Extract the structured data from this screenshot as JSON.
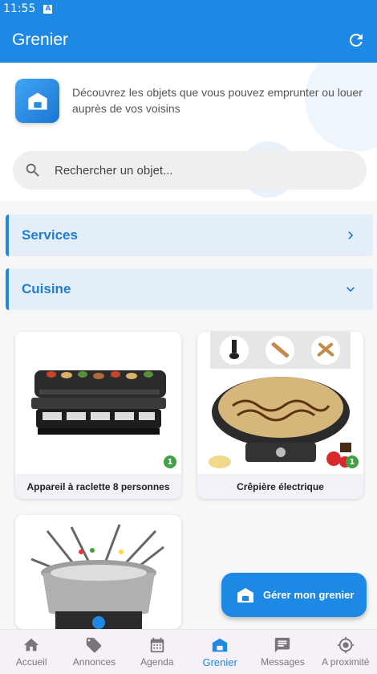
{
  "status_bar": {
    "time": "11:55",
    "notification_icon": "A"
  },
  "app_bar": {
    "title": "Grenier",
    "refresh_icon": "refresh-icon"
  },
  "header": {
    "intro_text": "Découvrez les objets que vous pouvez emprunter ou louer auprès de vos voisins",
    "icon": "grenier-house-icon"
  },
  "search": {
    "placeholder": "Rechercher un objet...",
    "value": ""
  },
  "categories": [
    {
      "label": "Services",
      "expanded": false,
      "icon": "chevron-right-icon"
    },
    {
      "label": "Cuisine",
      "expanded": true,
      "icon": "chevron-down-icon"
    }
  ],
  "items": [
    {
      "name": "Appareil à raclette 8 personnes",
      "count": "1",
      "image": "raclette-grill"
    },
    {
      "name": "Crêpière électrique",
      "count": "1",
      "image": "crepe-maker"
    },
    {
      "name": "",
      "image": "fondue-set"
    }
  ],
  "fab": {
    "label": "Gérer mon grenier",
    "icon": "grenier-house-icon"
  },
  "bottom_nav": {
    "items": [
      {
        "label": "Accueil",
        "icon": "home-icon",
        "active": false
      },
      {
        "label": "Annonces",
        "icon": "tag-icon",
        "active": false
      },
      {
        "label": "Agenda",
        "icon": "calendar-icon",
        "active": false
      },
      {
        "label": "Grenier",
        "icon": "grenier-house-icon",
        "active": true
      },
      {
        "label": "Messages",
        "icon": "message-icon",
        "active": false
      },
      {
        "label": "A proximité",
        "icon": "location-icon",
        "active": false
      }
    ]
  },
  "colors": {
    "primary": "#1e88e5",
    "badge": "#43a047",
    "category_bg": "#e3eef9"
  }
}
